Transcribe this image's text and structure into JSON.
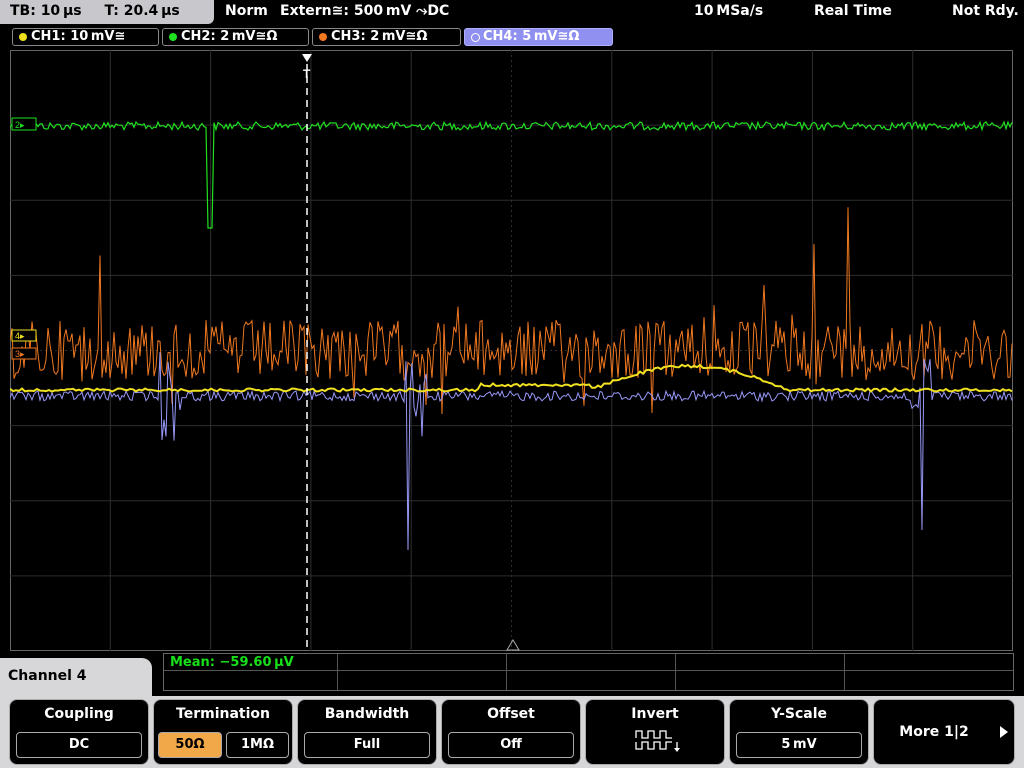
{
  "status": {
    "timebase": "TB: 10 µs",
    "trigger_time": "T: 20.4 µs",
    "mode": "Norm",
    "trigger_source": "Extern≅: 500 mV ⤳DC",
    "sample_rate": "10 MSa/s",
    "acq_mode": "Real Time",
    "state": "Not Rdy."
  },
  "channels": [
    {
      "label": "CH1: 10 mV≅",
      "color": "#f0e020"
    },
    {
      "label": "CH2: 2 mV≅Ω",
      "color": "#20e020"
    },
    {
      "label": "CH3: 2 mV≅Ω",
      "color": "#f07820"
    },
    {
      "label": "CH4: 5 mV≅Ω",
      "color": "#9898f8"
    }
  ],
  "markers": {
    "trigger": "T",
    "ch2": "2▸",
    "ch3": "3▸",
    "ch4": "4▸"
  },
  "measurement": {
    "label": "Mean: −59.60 µV"
  },
  "menu": {
    "title": "Channel 4"
  },
  "softkeys": {
    "coupling": {
      "label": "Coupling",
      "value": "DC"
    },
    "termination": {
      "label": "Termination",
      "options": [
        "50Ω",
        "1MΩ"
      ],
      "selected": "50Ω"
    },
    "bandwidth": {
      "label": "Bandwidth",
      "value": "Full"
    },
    "offset": {
      "label": "Offset",
      "value": "Off"
    },
    "invert": {
      "label": "Invert",
      "icon": "invert-waveform-icon"
    },
    "yscale": {
      "label": "Y-Scale",
      "value": "5 mV"
    },
    "more": {
      "label": "More 1|2"
    }
  }
}
